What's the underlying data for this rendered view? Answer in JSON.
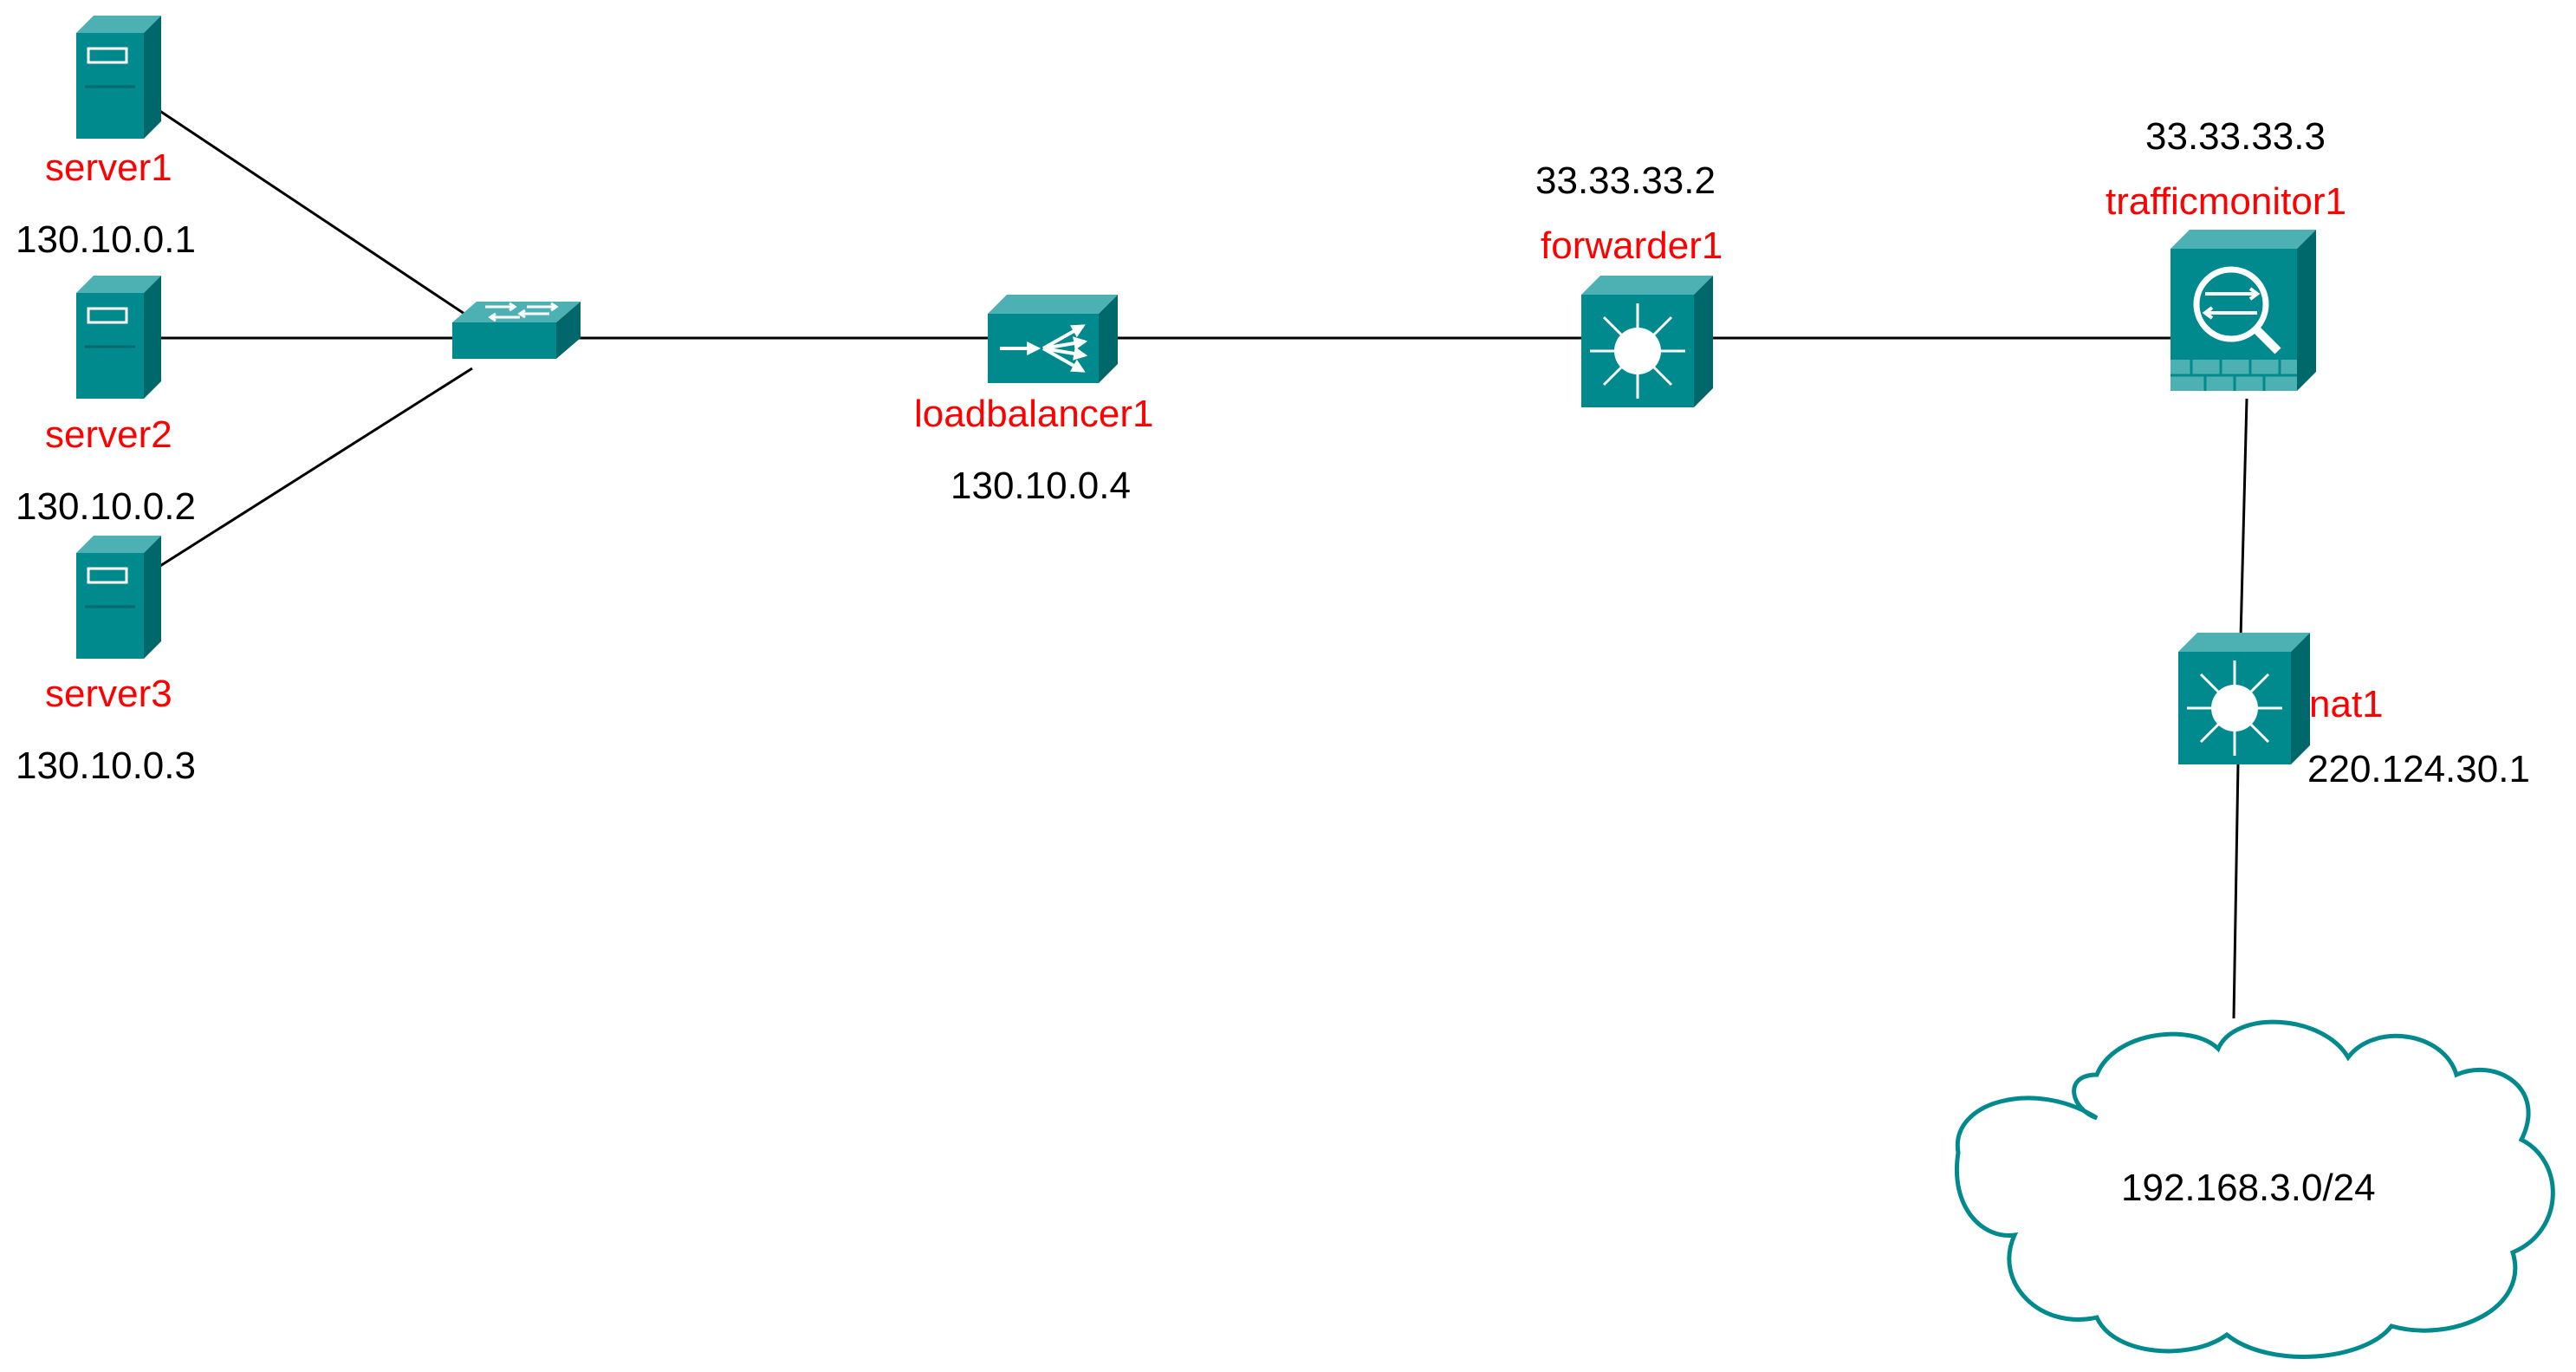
{
  "colors": {
    "device_face": "#008A8D",
    "device_top": "#4DB1B3",
    "device_side": "#00686B",
    "label_name": "#ff0000",
    "label_address": "#000000",
    "link": "#000000"
  },
  "nodes": {
    "server1": {
      "name": "server1",
      "address": "130.10.0.1",
      "icon": "server-icon"
    },
    "server2": {
      "name": "server2",
      "address": "130.10.0.2",
      "icon": "server-icon"
    },
    "server3": {
      "name": "server3",
      "address": "130.10.0.3",
      "icon": "server-icon"
    },
    "switch": {
      "icon": "switch-icon"
    },
    "loadbalancer1": {
      "name": "loadbalancer1",
      "address": "130.10.0.4",
      "icon": "load-balancer-icon"
    },
    "forwarder1": {
      "name": "forwarder1",
      "address": "33.33.33.2",
      "icon": "layer3-switch-icon"
    },
    "trafficmonitor1": {
      "name": "trafficmonitor1",
      "address": "33.33.33.3",
      "icon": "traffic-monitor-icon"
    },
    "nat1": {
      "name": "nat1",
      "address": "220.124.30.1",
      "icon": "layer3-switch-icon"
    },
    "cloud": {
      "label": "192.168.3.0/24",
      "icon": "cloud-icon"
    }
  },
  "links": [
    [
      "server1",
      "switch"
    ],
    [
      "server2",
      "switch"
    ],
    [
      "server3",
      "switch"
    ],
    [
      "switch",
      "loadbalancer1"
    ],
    [
      "loadbalancer1",
      "forwarder1"
    ],
    [
      "forwarder1",
      "trafficmonitor1"
    ],
    [
      "trafficmonitor1",
      "nat1"
    ],
    [
      "nat1",
      "cloud"
    ]
  ]
}
